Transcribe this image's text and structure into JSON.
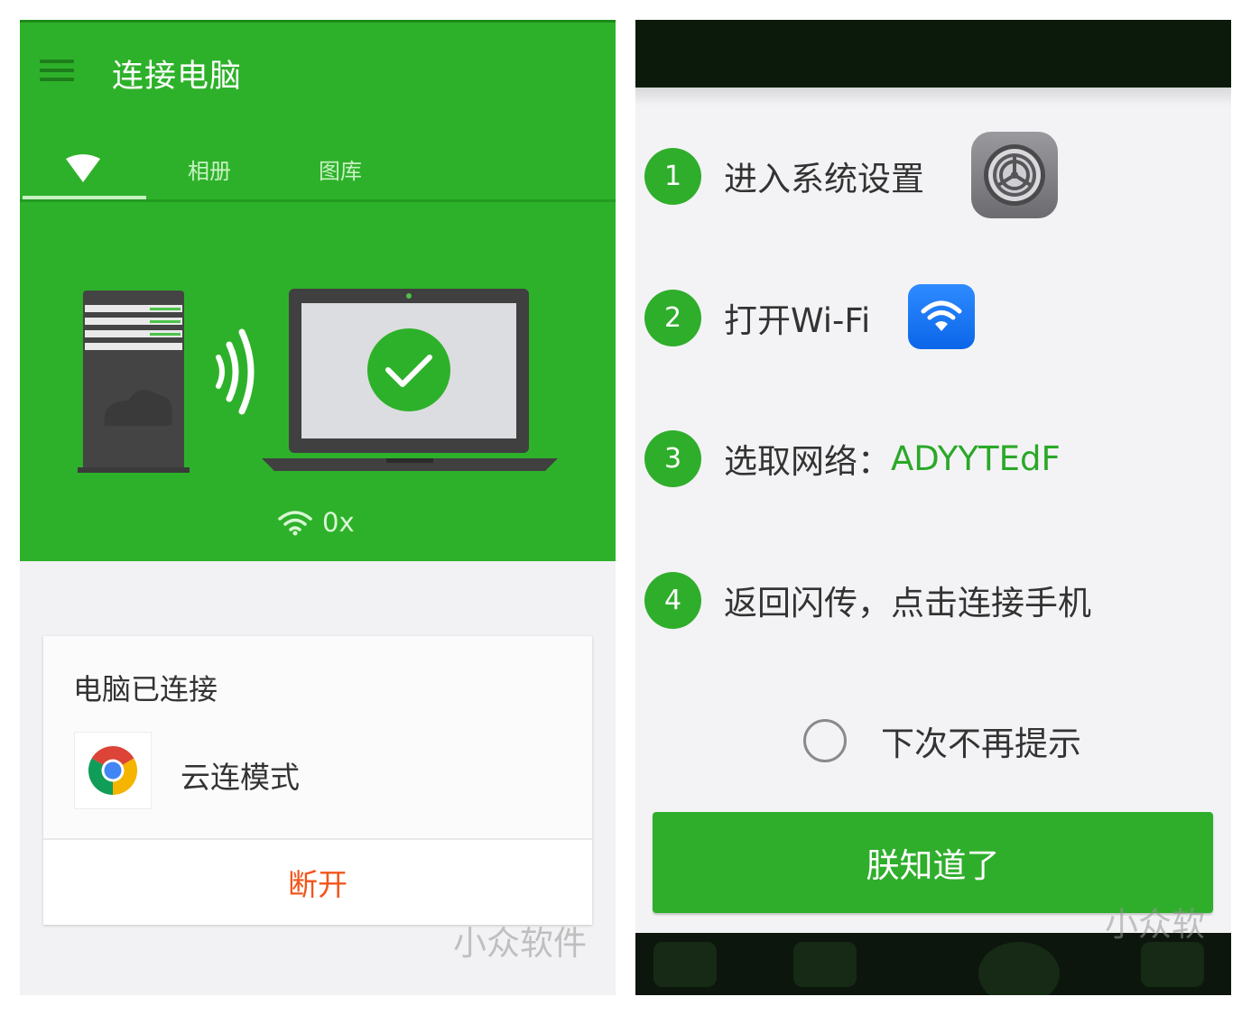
{
  "left": {
    "title": "连接电脑",
    "tabs": {
      "album": "相册",
      "gallery": "图库"
    },
    "wifi_status_value": "0x",
    "card": {
      "title": "电脑已连接",
      "mode_label": "云连模式",
      "disconnect_label": "断开"
    },
    "watermark": "小众软件",
    "colors": {
      "primary": "#2eb12a",
      "disconnect": "#f2551b"
    }
  },
  "right": {
    "steps": [
      {
        "num": "1",
        "text": "进入系统设置",
        "icon": "settings-gear-icon"
      },
      {
        "num": "2",
        "text": "打开Wi-Fi",
        "icon": "wifi-icon"
      },
      {
        "num": "3",
        "text": "选取网络：",
        "accent": "ADYYTEdF"
      },
      {
        "num": "4",
        "text": "返回闪传，点击连接手机"
      }
    ],
    "no_remind_label": "下次不再提示",
    "ok_button_label": "朕知道了",
    "watermark": "小众软",
    "colors": {
      "accent": "#2aa828",
      "button": "#2fae2b"
    }
  }
}
